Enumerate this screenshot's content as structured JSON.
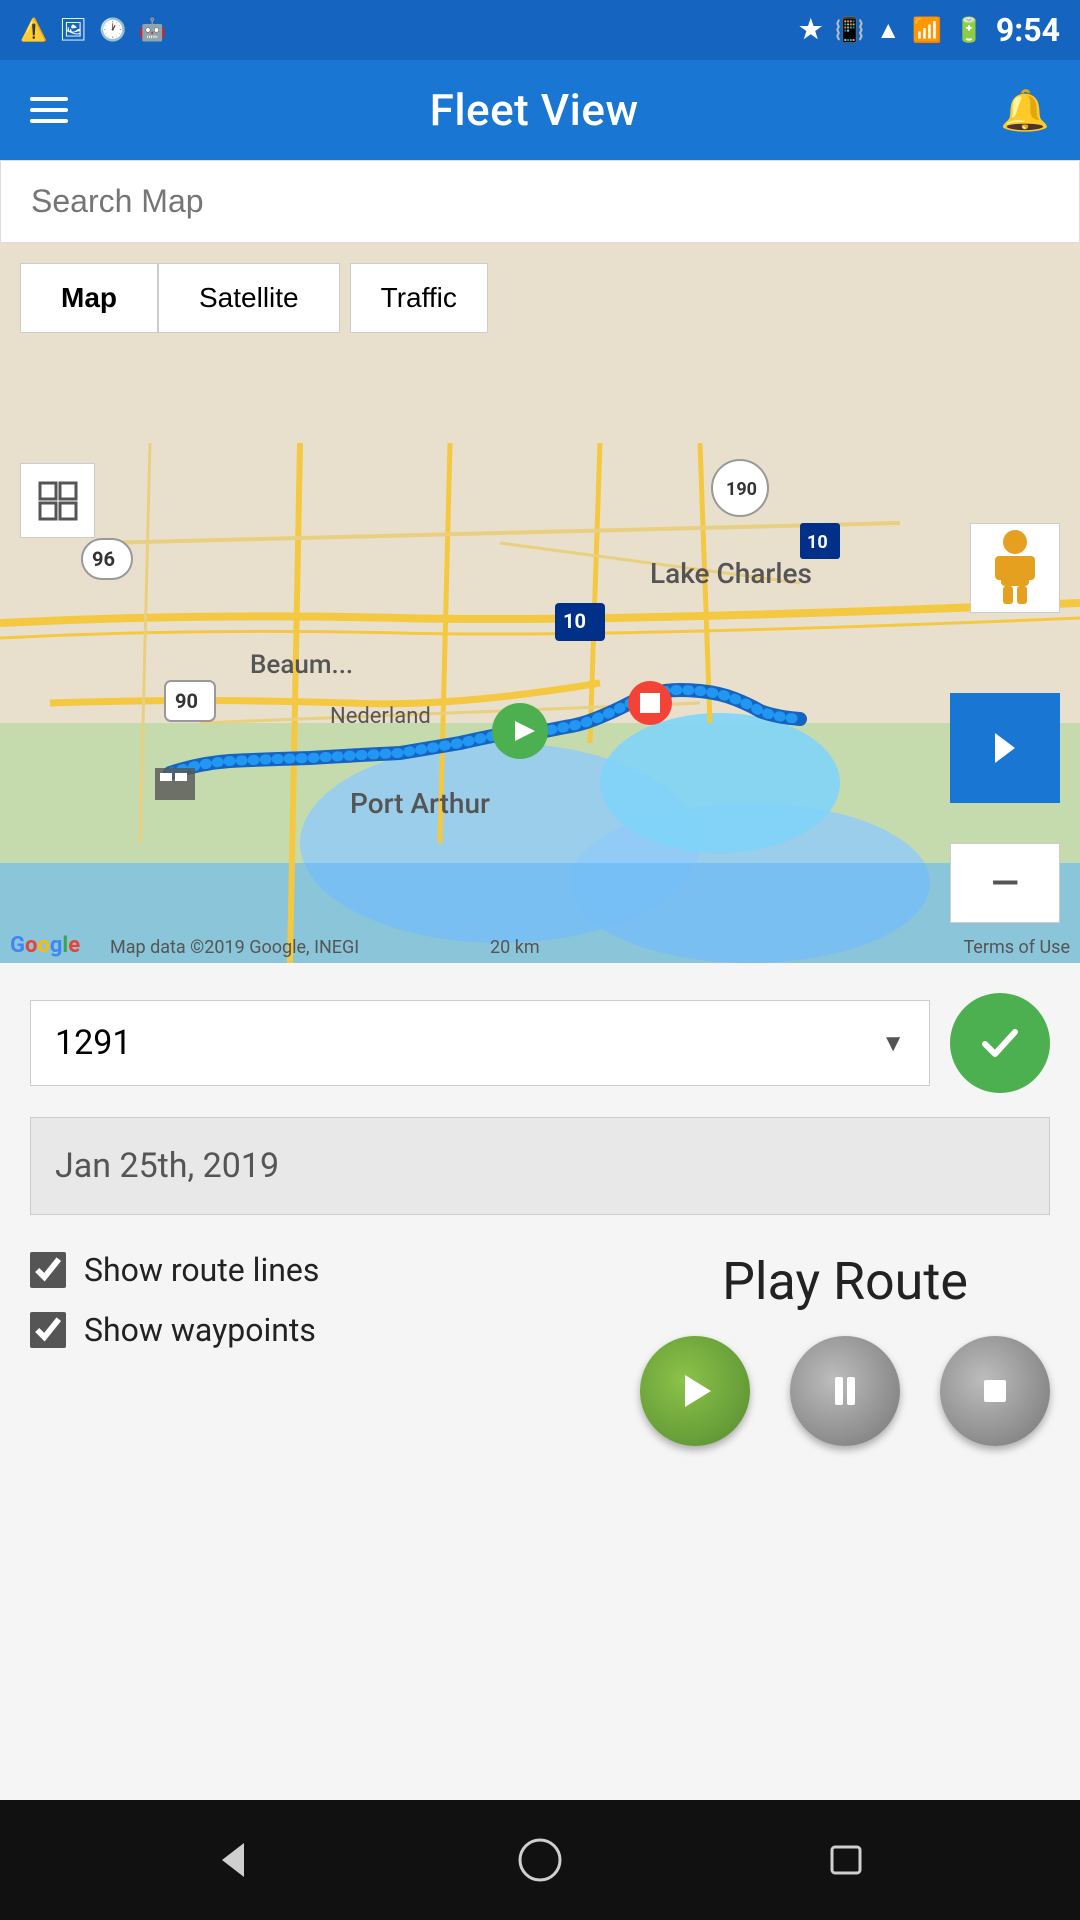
{
  "statusBar": {
    "time": "9:54",
    "icons": [
      "warning-icon",
      "image-icon",
      "clock-icon",
      "android-icon",
      "bluetooth-icon",
      "vibrate-icon",
      "wifi-icon",
      "signal-icon",
      "battery-icon"
    ]
  },
  "header": {
    "title": "Fleet View",
    "menuLabel": "menu",
    "bellLabel": "notifications"
  },
  "search": {
    "placeholder": "Search Map"
  },
  "map": {
    "buttons": {
      "map": "Map",
      "satellite": "Satellite",
      "traffic": "Traffic"
    },
    "attribution": "Map data ©2019 Google, INEGI",
    "scale": "20 km",
    "terms": "Terms of Use"
  },
  "bottomPanel": {
    "dropdown": {
      "value": "1291",
      "arrow": "▼"
    },
    "date": "Jan 25th, 2019",
    "checkboxes": {
      "routeLines": "Show route lines",
      "waypoints": "Show waypoints"
    },
    "playRoute": {
      "title": "Play Route"
    },
    "controls": {
      "play": "play",
      "pause": "pause",
      "stop": "stop"
    }
  },
  "navBar": {
    "back": "back",
    "home": "home",
    "recents": "recents"
  }
}
